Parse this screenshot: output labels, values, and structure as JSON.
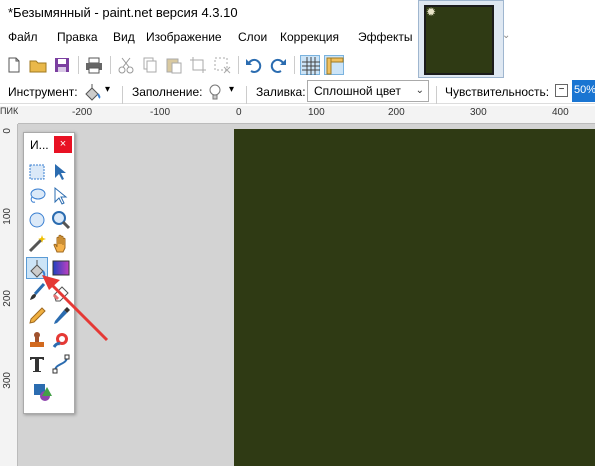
{
  "window": {
    "title": "*Безымянный - paint.net версия 4.3.10"
  },
  "menu": {
    "items": [
      "Файл",
      "Правка",
      "Вид",
      "Изображение",
      "Слои",
      "Коррекция",
      "Эффекты"
    ]
  },
  "toolbar": {
    "buttons": [
      "new-icon",
      "open-icon",
      "save-icon",
      "print-icon",
      "cut-icon",
      "copy-icon",
      "paste-icon",
      "crop-icon",
      "deselect-icon",
      "undo-icon",
      "redo-icon",
      "grid-icon",
      "rulers-icon"
    ]
  },
  "tool_options": {
    "tool_label": "Инструмент:",
    "fill_label": "Заполнение:",
    "flood_label": "Заливка:",
    "flood_value": "Сплошной цвет",
    "sensitivity_label": "Чувствительность:",
    "sensitivity_value": "50%"
  },
  "rulers": {
    "corner": "ПИК",
    "top": [
      "-200",
      "-100",
      "0",
      "100",
      "200",
      "300",
      "400"
    ],
    "left": [
      "0",
      "100",
      "200",
      "300"
    ]
  },
  "tools_window": {
    "title": "И...",
    "close": "×",
    "tools": [
      "rectangle-select-icon",
      "move-selection-icon",
      "lasso-select-icon",
      "move-selected-icon",
      "ellipse-select-icon",
      "zoom-icon",
      "magic-wand-icon",
      "pan-icon",
      "paint-bucket-icon",
      "gradient-icon",
      "paintbrush-icon",
      "eraser-icon",
      "pencil-icon",
      "color-picker-icon",
      "clone-stamp-icon",
      "recolor-icon",
      "text-icon",
      "line-curve-icon",
      "shapes-icon"
    ],
    "active_tool": "paint-bucket-icon"
  },
  "colors": {
    "canvas": "#2f3a14",
    "workspace": "#d3d3d3",
    "accent": "#1a75d2",
    "annotation_arrow": "#e53935"
  }
}
